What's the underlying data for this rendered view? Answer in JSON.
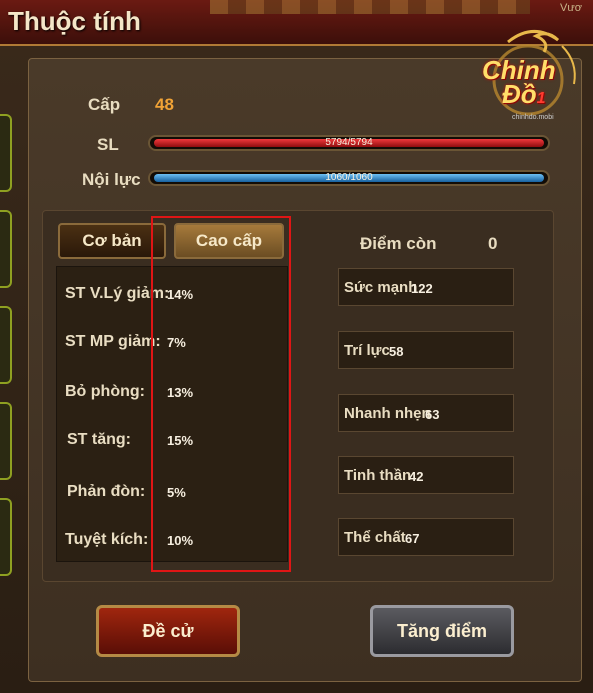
{
  "window": {
    "title": "Thuộc tính",
    "corner_text": "Vươ"
  },
  "logo": {
    "line1": "Chinh",
    "line2": "Đồ",
    "badge": "1",
    "url_text": "chinhdo.mobi"
  },
  "summary": {
    "level_label": "Cấp",
    "level_value": "48",
    "hp_label": "SL",
    "hp_text": "5794/5794",
    "hp_fraction": 1.0,
    "mp_label": "Nội lực",
    "mp_text": "1060/1060",
    "mp_fraction": 1.0
  },
  "tabs": [
    {
      "label": "Cơ bản",
      "active": false
    },
    {
      "label": "Cao cấp",
      "active": true
    }
  ],
  "advanced_stats": [
    {
      "label": "ST V.Lý giảm:",
      "value": "14%"
    },
    {
      "label": "ST MP giảm:",
      "value": "7%"
    },
    {
      "label": "Bỏ phòng:",
      "value": "13%"
    },
    {
      "label": "ST tăng:",
      "value": "15%"
    },
    {
      "label": "Phản đòn:",
      "value": "5%"
    },
    {
      "label": "Tuyệt kích:",
      "value": "10%"
    }
  ],
  "points": {
    "label": "Điểm còn",
    "value": "0"
  },
  "attributes": [
    {
      "label": "Sức mạnh",
      "value": "122"
    },
    {
      "label": "Trí lực",
      "value": "58"
    },
    {
      "label": "Nhanh nhẹn",
      "value": "63"
    },
    {
      "label": "Tinh thần",
      "value": "42"
    },
    {
      "label": "Thể chất",
      "value": "67"
    }
  ],
  "buttons": {
    "recommend": "Đề cử",
    "add_points": "Tăng điểm"
  },
  "colors": {
    "hp": "#c8171a",
    "mp": "#2a86d6",
    "highlight": "#e01515",
    "level": "#f1a336"
  }
}
